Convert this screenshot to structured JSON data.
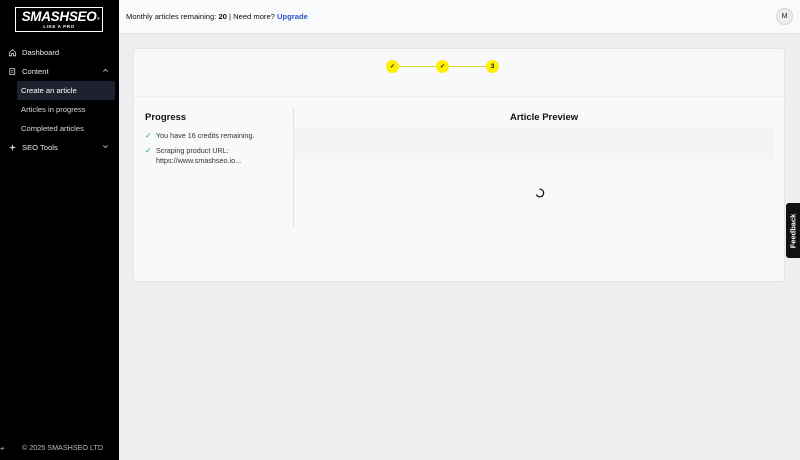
{
  "brand": {
    "name": "SMASHSEO",
    "tagline": "LIKE A PRO",
    "reg": "®"
  },
  "sidebar": {
    "items": [
      {
        "label": "Dashboard",
        "icon": "home-icon"
      },
      {
        "label": "Content",
        "icon": "document-icon",
        "expanded": true,
        "children": [
          {
            "label": "Create an article",
            "active": true
          },
          {
            "label": "Articles in progress"
          },
          {
            "label": "Completed articles"
          }
        ]
      },
      {
        "label": "SEO Tools",
        "icon": "sparkle-icon",
        "expanded": false
      }
    ],
    "copyright": "© 2025 SMASHSEO LTD"
  },
  "topbar": {
    "prefix": "Monthly articles remaining:",
    "count": "20",
    "separator": "| Need more?",
    "upgrade": "Upgrade",
    "avatar": "M"
  },
  "steps": [
    {
      "label": "✓",
      "state": "done"
    },
    {
      "label": "✓",
      "state": "done"
    },
    {
      "label": "3",
      "state": "current"
    }
  ],
  "progress": {
    "title": "Progress",
    "items": [
      {
        "text": "You have 16 credits remaining."
      },
      {
        "line1": "Scraping product URL:",
        "line2": "https://www.smashseo.io..."
      }
    ]
  },
  "preview": {
    "title": "Article Preview"
  },
  "feedback": {
    "label": "Feedback"
  },
  "colors": {
    "accent": "#ffee00",
    "link": "#2b56c9",
    "check": "#22b14c",
    "sidebar": "#000000"
  }
}
